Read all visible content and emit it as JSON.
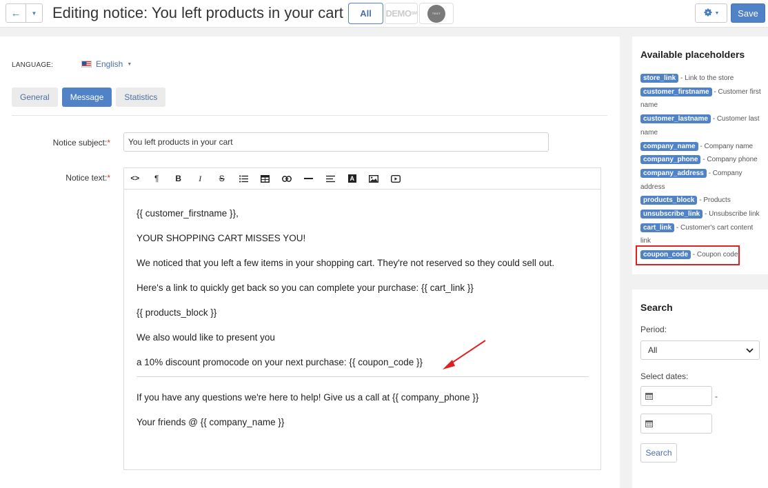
{
  "header": {
    "title": "Editing notice: You left products in your cart",
    "back_icon": "arrow-left-icon",
    "presets": {
      "all_label": "All",
      "demo_label": "DEMO",
      "demo_sup": "SM",
      "test_label": "TEST"
    },
    "save_label": "Save"
  },
  "language": {
    "label": "LANGUAGE:",
    "value": "English"
  },
  "tabs": [
    {
      "label": "General",
      "active": false
    },
    {
      "label": "Message",
      "active": true
    },
    {
      "label": "Statistics",
      "active": false
    }
  ],
  "form": {
    "subject_label": "Notice subject:",
    "subject_value": "You left products in your cart",
    "text_label": "Notice text:",
    "required_mark": "*"
  },
  "editor": {
    "toolbar": [
      "code",
      "paragraph",
      "bold",
      "italic",
      "strikethrough",
      "bullet-list",
      "table",
      "link",
      "horizontal-rule",
      "align",
      "font-color",
      "image",
      "video"
    ],
    "paragraphs_top": [
      "{{ customer_firstname }},",
      "YOUR SHOPPING CART MISSES YOU!",
      "We noticed that you left a few items in your shopping cart. They're not reserved so they could sell out.",
      "Here's a link to quickly get back so you can complete your purchase: {{ cart_link }}",
      "{{ products_block }}",
      "We also would like to present you",
      "a 10% discount promocode on your next purchase: {{ coupon_code }}"
    ],
    "paragraphs_bottom": [
      "If you have any questions we're here to help! Give us a call at {{ company_phone }}",
      "Your friends @ {{ company_name }}"
    ]
  },
  "placeholders": {
    "title": "Available placeholders",
    "items": [
      {
        "tag": "store_link",
        "desc": " - Link to the store"
      },
      {
        "tag": "customer_firstname",
        "desc": " - Customer first name"
      },
      {
        "tag": "customer_lastname",
        "desc": " - Customer last name"
      },
      {
        "tag": "company_name",
        "desc": " - Company name"
      },
      {
        "tag": "company_phone",
        "desc": " - Company phone"
      },
      {
        "tag": "company_address",
        "desc": " - Company address"
      },
      {
        "tag": "products_block",
        "desc": " - Products"
      },
      {
        "tag": "unsubscribe_link",
        "desc": " - Unsubscribe link"
      },
      {
        "tag": "cart_link",
        "desc": " - Customer's cart content link"
      },
      {
        "tag": "coupon_code",
        "desc": " - Coupon code"
      }
    ]
  },
  "search": {
    "title": "Search",
    "period_label": "Period:",
    "period_value": "All",
    "dates_label": "Select dates:",
    "date_separator": "-",
    "button_label": "Search"
  },
  "colors": {
    "accent": "#4f82c6",
    "highlight": "#e02020",
    "required": "#dd3333"
  }
}
